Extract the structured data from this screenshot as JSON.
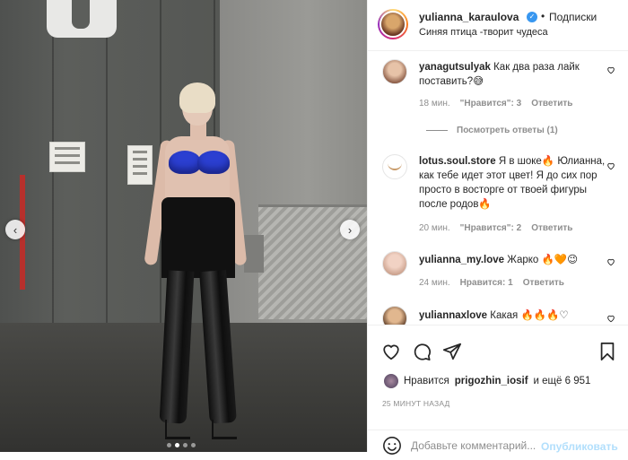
{
  "post": {
    "image_alt_dots": 4,
    "active_dot": 2
  },
  "header": {
    "username": "yulianna_karaulova",
    "separator": "•",
    "follow_label": "Подписки",
    "location": "Синяя птица -творит чудеса"
  },
  "comments": [
    {
      "username": "yanagutsulyak",
      "text": "Как два раза лайк поставить?😅",
      "time": "18 мин.",
      "likes": "\"Нравится\": 3",
      "reply": "Ответить"
    },
    {
      "view_replies": "Посмотреть ответы (1)"
    },
    {
      "username": "lotus.soul.store",
      "text": "Я в шоке🔥 Юлианна, как тебе идет этот цвет! Я до сих пор просто в восторге от твоей фигуры после родов🔥",
      "time": "20 мин.",
      "likes": "\"Нравится\": 2",
      "reply": "Ответить"
    },
    {
      "username": "yulianna_my.love",
      "text": "Жарко 🔥🧡😉",
      "time": "24 мин.",
      "likes": "Нравится: 1",
      "reply": "Ответить"
    },
    {
      "username": "yuliannaxlove",
      "text": "Какая 🔥🔥🔥♡"
    }
  ],
  "likes_bar": {
    "prefix": "Нравится",
    "user": "prigozhin_iosif",
    "suffix": "и ещё 6 951"
  },
  "timestamp": "25 МИНУТ НАЗАД",
  "add_comment": {
    "placeholder": "Добавьте комментарий...",
    "publish": "Опубликовать"
  },
  "colors": {
    "link": "#3897f0",
    "muted": "#8e8e8e",
    "publish_disabled": "#b2dffc"
  }
}
